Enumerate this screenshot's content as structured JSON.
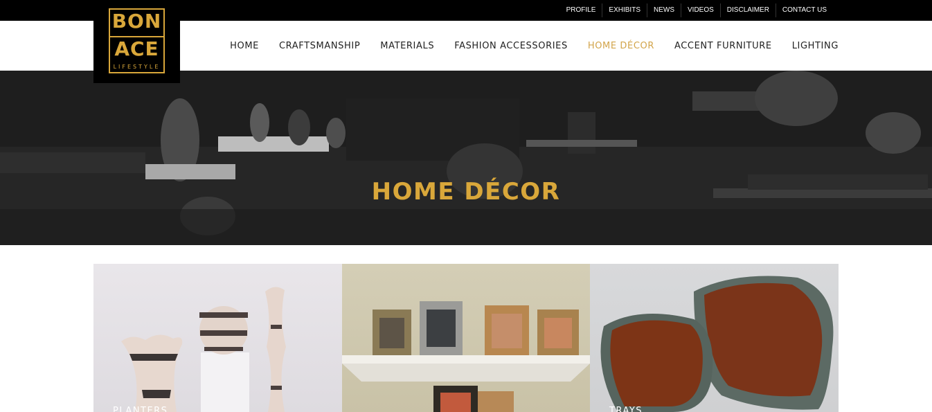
{
  "brand": {
    "line1": "BON",
    "line2": "ACE",
    "tagline": "LIFESTYLE",
    "accent": "#d9a73a"
  },
  "top_links": [
    "PROFILE",
    "EXHIBITS",
    "NEWS",
    "VIDEOS",
    "DISCLAIMER",
    "CONTACT US"
  ],
  "nav": {
    "items": [
      "HOME",
      "CRAFTSMANSHIP",
      "MATERIALS",
      "FASHION ACCESSORIES",
      "HOME DÉCOR",
      "ACCENT FURNITURE",
      "LIGHTING"
    ],
    "active": "HOME DÉCOR",
    "active_color": "#d2a44a"
  },
  "hero": {
    "title": "HOME DÉCOR"
  },
  "categories": [
    {
      "label": "PLANTERS"
    },
    {
      "label": ""
    },
    {
      "label": "TRAYS"
    }
  ]
}
